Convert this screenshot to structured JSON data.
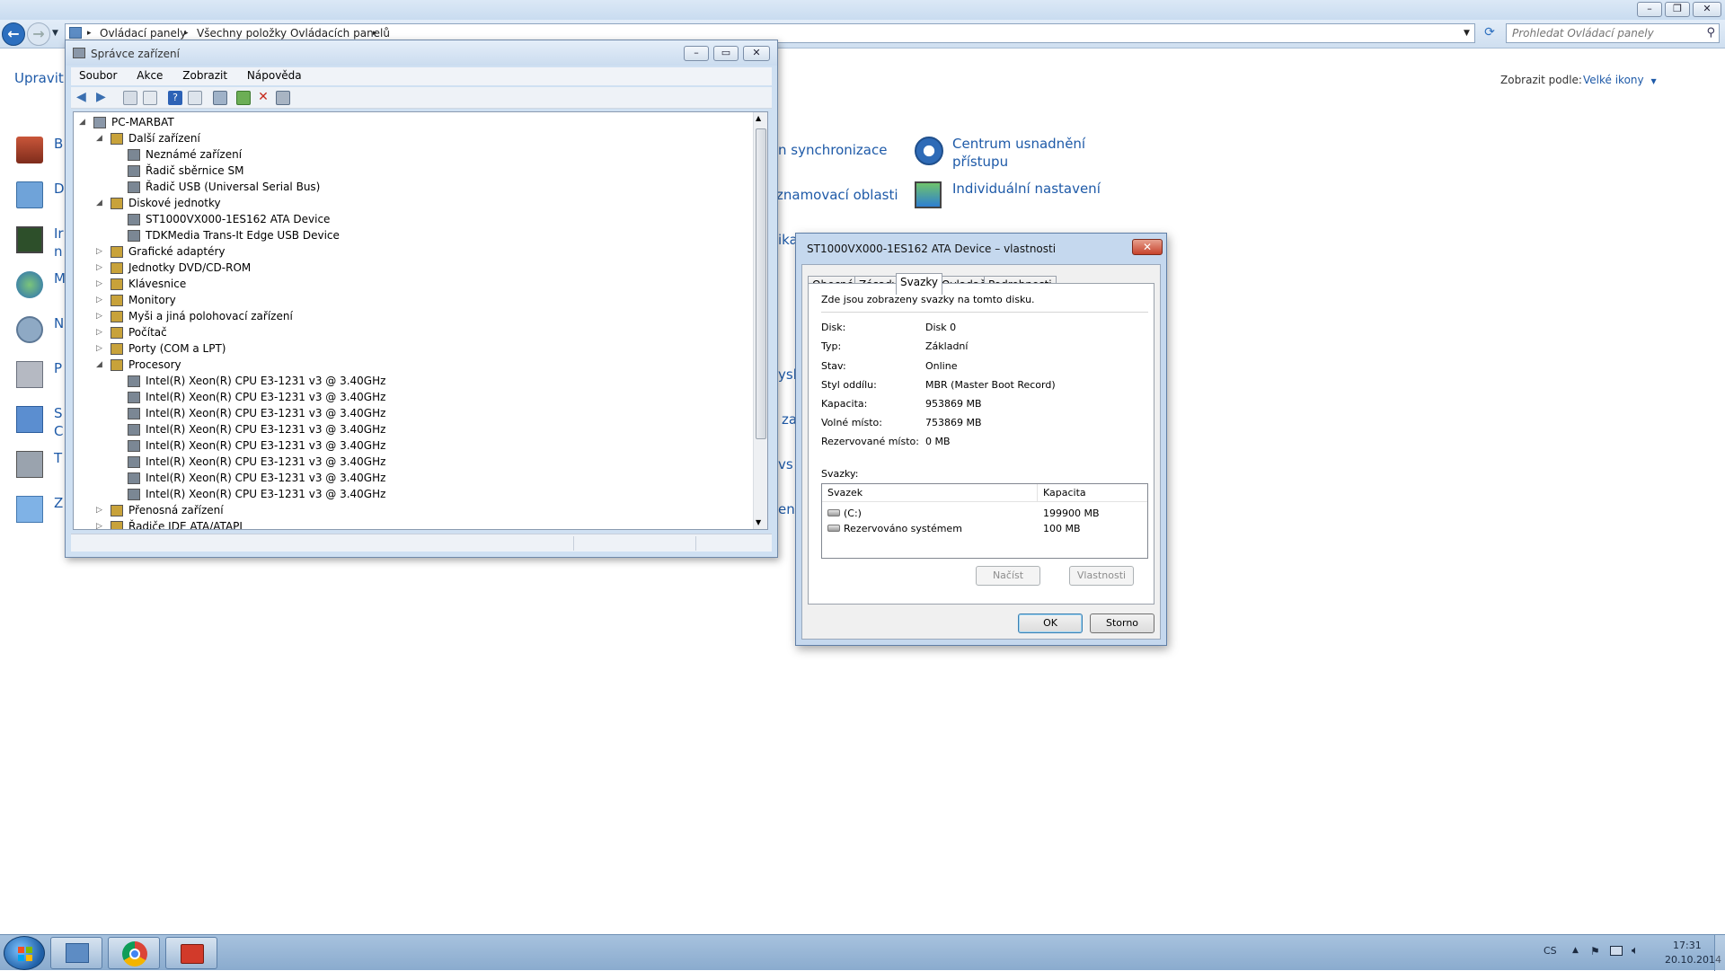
{
  "explorer": {
    "address_crumbs": [
      "Ovládací panely",
      "Všechny položky Ovládacích panelů"
    ],
    "search_placeholder": "Prohledat Ovládací panely",
    "toolbar_left": "Upravit",
    "view_by_label": "Zobrazit podle:",
    "view_by_value": "Velké ikony",
    "items_left_fragments": [
      "B",
      "D",
      "Ir",
      "n",
      "M",
      "N",
      "P",
      "S",
      "C",
      "T",
      "Z"
    ],
    "items_mid_fragments": [
      "n synchronizace",
      "znamovací oblasti",
      "ika",
      "yská",
      "za",
      "vs D",
      "ení"
    ],
    "items_right": [
      "Centrum usnadnění",
      "přístupu",
      "Individuální nastavení"
    ]
  },
  "device_manager": {
    "title": "Správce zařízení",
    "menu": [
      "Soubor",
      "Akce",
      "Zobrazit",
      "Nápověda"
    ],
    "tree": [
      {
        "text": "PC-MARBAT",
        "level": 0,
        "expanded": true
      },
      {
        "text": "Další zařízení",
        "level": 1,
        "expanded": true
      },
      {
        "text": "Neznámé zařízení",
        "level": 2
      },
      {
        "text": "Řadič sběrnice SM",
        "level": 2
      },
      {
        "text": "Řadič USB (Universal Serial Bus)",
        "level": 2
      },
      {
        "text": "Diskové jednotky",
        "level": 1,
        "expanded": true
      },
      {
        "text": "ST1000VX000-1ES162 ATA Device",
        "level": 2
      },
      {
        "text": "TDKMedia Trans-It Edge USB Device",
        "level": 2
      },
      {
        "text": "Grafické adaptéry",
        "level": 1,
        "expanded": false
      },
      {
        "text": "Jednotky DVD/CD-ROM",
        "level": 1,
        "expanded": false
      },
      {
        "text": "Klávesnice",
        "level": 1,
        "expanded": false
      },
      {
        "text": "Monitory",
        "level": 1,
        "expanded": false
      },
      {
        "text": "Myši a jiná polohovací zařízení",
        "level": 1,
        "expanded": false
      },
      {
        "text": "Počítač",
        "level": 1,
        "expanded": false
      },
      {
        "text": "Porty (COM a LPT)",
        "level": 1,
        "expanded": false
      },
      {
        "text": "Procesory",
        "level": 1,
        "expanded": true
      },
      {
        "text": "Intel(R) Xeon(R) CPU E3-1231 v3 @ 3.40GHz",
        "level": 2
      },
      {
        "text": "Intel(R) Xeon(R) CPU E3-1231 v3 @ 3.40GHz",
        "level": 2
      },
      {
        "text": "Intel(R) Xeon(R) CPU E3-1231 v3 @ 3.40GHz",
        "level": 2
      },
      {
        "text": "Intel(R) Xeon(R) CPU E3-1231 v3 @ 3.40GHz",
        "level": 2
      },
      {
        "text": "Intel(R) Xeon(R) CPU E3-1231 v3 @ 3.40GHz",
        "level": 2
      },
      {
        "text": "Intel(R) Xeon(R) CPU E3-1231 v3 @ 3.40GHz",
        "level": 2
      },
      {
        "text": "Intel(R) Xeon(R) CPU E3-1231 v3 @ 3.40GHz",
        "level": 2
      },
      {
        "text": "Intel(R) Xeon(R) CPU E3-1231 v3 @ 3.40GHz",
        "level": 2
      },
      {
        "text": "Přenosná zařízení",
        "level": 1,
        "expanded": false
      },
      {
        "text": "Řadiče IDE ATA/ATAPI",
        "level": 1,
        "expanded": false
      }
    ]
  },
  "properties": {
    "title": "ST1000VX000-1ES162 ATA Device – vlastnosti",
    "tabs": [
      "Obecné",
      "Zásady",
      "Svazky",
      "Ovladač",
      "Podrobnosti"
    ],
    "active_tab": "Svazky",
    "intro": "Zde jsou zobrazeny svazky na tomto disku.",
    "fields": [
      {
        "label": "Disk:",
        "value": "Disk 0"
      },
      {
        "label": "Typ:",
        "value": "Základní"
      },
      {
        "label": "Stav:",
        "value": "Online"
      },
      {
        "label": "Styl oddílu:",
        "value": "MBR (Master Boot Record)"
      },
      {
        "label": "Kapacita:",
        "value": "953869 MB"
      },
      {
        "label": "Volné místo:",
        "value": "753869 MB"
      },
      {
        "label": "Rezervované místo:",
        "value": "0 MB"
      }
    ],
    "volumes_label": "Svazky:",
    "volume_columns": [
      "Svazek",
      "Kapacita"
    ],
    "volumes": [
      {
        "name": "(C:)",
        "capacity": "199900 MB"
      },
      {
        "name": "Rezervováno systémem",
        "capacity": "100 MB"
      }
    ],
    "load_button": "Načíst",
    "properties_button": "Vlastnosti",
    "ok_button": "OK",
    "cancel_button": "Storno"
  },
  "taskbar": {
    "language": "CS",
    "time": "17:31",
    "date": "20.10.2014"
  },
  "colors": {
    "link_blue": "#1e5aa8",
    "window_frame": "#cfe0f2",
    "taskbar": "#9ab7d6"
  }
}
